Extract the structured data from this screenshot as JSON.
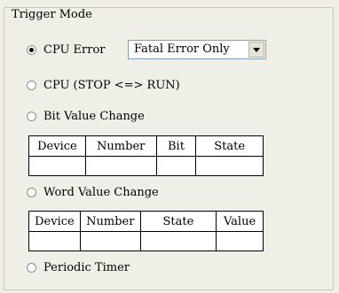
{
  "group": {
    "title": "Trigger Mode"
  },
  "options": {
    "cpu_error": {
      "label": "CPU Error",
      "checked": true
    },
    "cpu_stop_run": {
      "label": "CPU (STOP <=> RUN)",
      "checked": false
    },
    "bit_value_change": {
      "label": "Bit Value Change",
      "checked": false
    },
    "word_value_change": {
      "label": "Word Value Change",
      "checked": false
    },
    "periodic_timer": {
      "label": "Periodic Timer",
      "checked": false
    }
  },
  "cpu_error_combo": {
    "value": "Fatal Error Only"
  },
  "bit_table": {
    "columns": [
      "Device",
      "Number",
      "Bit",
      "State"
    ],
    "rows": [
      [
        "",
        "",
        "",
        ""
      ]
    ]
  },
  "word_table": {
    "columns": [
      "Device",
      "Number",
      "State",
      "Value"
    ],
    "rows": [
      [
        "",
        "",
        "",
        ""
      ]
    ]
  }
}
